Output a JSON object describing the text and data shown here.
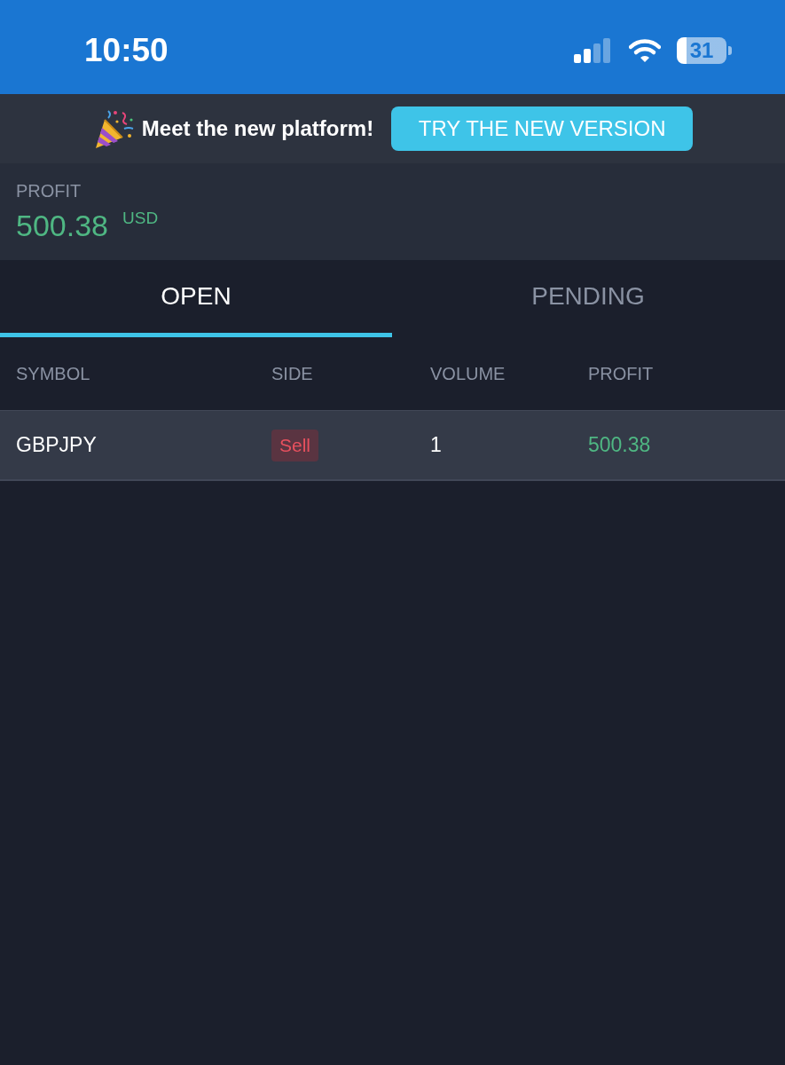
{
  "status_bar": {
    "time": "10:50",
    "battery": "31"
  },
  "banner": {
    "message": "Meet the new platform!",
    "button": "TRY THE NEW VERSION"
  },
  "summary": {
    "label": "PROFIT",
    "value": "500.38",
    "currency": "USD"
  },
  "tabs": [
    {
      "label": "OPEN",
      "selected": true
    },
    {
      "label": "PENDING",
      "selected": false
    }
  ],
  "table": {
    "columns": [
      "SYMBOL",
      "SIDE",
      "VOLUME",
      "PROFIT"
    ],
    "rows": [
      {
        "symbol": "GBPJPY",
        "side": "Sell",
        "kind": "sell",
        "volume": "1",
        "profit": "500.38"
      }
    ]
  }
}
